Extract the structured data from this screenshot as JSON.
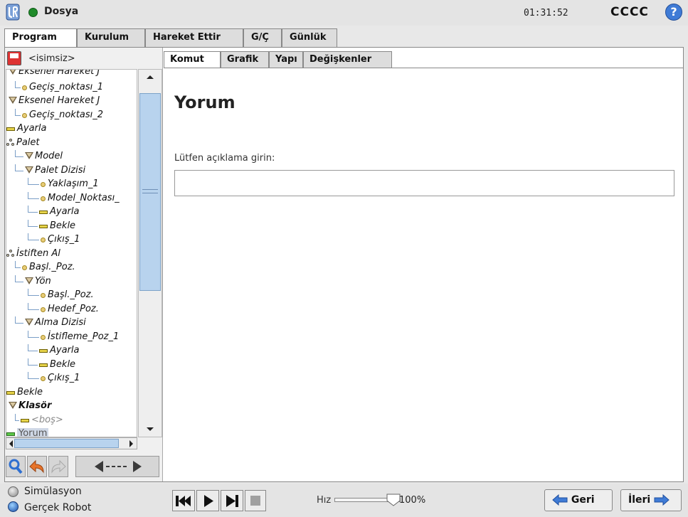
{
  "header": {
    "file_menu": "Dosya",
    "clock": "01:31:52",
    "robot_name": "CCCC",
    "help": "?"
  },
  "main_tabs": [
    {
      "label": "Program",
      "active": true
    },
    {
      "label": "Kurulum",
      "active": false
    },
    {
      "label": "Hareket Ettir",
      "active": false
    },
    {
      "label": "G/Ç",
      "active": false
    },
    {
      "label": "Günlük",
      "active": false
    }
  ],
  "program": {
    "name": "<isimsiz>"
  },
  "tree": [
    {
      "label": "Eksenel Hareket J",
      "icon": "move-icon"
    },
    {
      "label": "Geçiş_noktası_1",
      "icon": "waypoint-icon"
    },
    {
      "label": "Eksenel Hareket J",
      "icon": "move-icon"
    },
    {
      "label": "Geçiş_noktası_2",
      "icon": "waypoint-icon"
    },
    {
      "label": "Ayarla",
      "icon": "set-icon"
    },
    {
      "label": "Palet",
      "icon": "pallet-icon"
    },
    {
      "label": "Model",
      "icon": "move-icon"
    },
    {
      "label": "Palet Dizisi",
      "icon": "move-icon"
    },
    {
      "label": "Yaklaşım_1",
      "icon": "waypoint-icon"
    },
    {
      "label": "Model_Noktası_",
      "icon": "waypoint-icon"
    },
    {
      "label": "Ayarla",
      "icon": "set-icon"
    },
    {
      "label": "Bekle",
      "icon": "wait-icon"
    },
    {
      "label": "Çıkış_1",
      "icon": "waypoint-icon"
    },
    {
      "label": "İstiften Al",
      "icon": "pallet-icon"
    },
    {
      "label": "Başl._Poz.",
      "icon": "waypoint-icon"
    },
    {
      "label": "Yön",
      "icon": "move-icon"
    },
    {
      "label": "Başl._Poz.",
      "icon": "waypoint-icon"
    },
    {
      "label": "Hedef_Poz.",
      "icon": "waypoint-icon"
    },
    {
      "label": "Alma Dizisi",
      "icon": "move-icon"
    },
    {
      "label": "İstifleme_Poz_1",
      "icon": "waypoint-icon"
    },
    {
      "label": "Ayarla",
      "icon": "set-icon"
    },
    {
      "label": "Bekle",
      "icon": "wait-icon"
    },
    {
      "label": "Çıkış_1",
      "icon": "waypoint-icon"
    },
    {
      "label": "Bekle",
      "icon": "wait-icon"
    },
    {
      "label": "Klasör",
      "icon": "folder-icon"
    },
    {
      "label": "<boş>",
      "icon": "empty-icon"
    },
    {
      "label": "Yorum",
      "icon": "comment-icon",
      "selected": true
    }
  ],
  "sub_tabs": [
    {
      "label": "Komut",
      "active": true
    },
    {
      "label": "Grafik",
      "active": false
    },
    {
      "label": "Yapı",
      "active": false
    },
    {
      "label": "Değişkenler",
      "active": false
    }
  ],
  "command": {
    "title": "Yorum",
    "prompt": "Lütfen açıklama girin:",
    "value": ""
  },
  "mode": {
    "simulation": "Simülasyon",
    "real_robot": "Gerçek Robot",
    "selected": "Gerçek Robot"
  },
  "speed": {
    "label": "Hız",
    "value_text": "100%",
    "fraction": 1.0
  },
  "navigation": {
    "back": "Geri",
    "next": "İleri"
  },
  "colors": {
    "accent_blue": "#3f7bd6",
    "selection": "#b8d3ee",
    "wait_yellow": "#e6d34a",
    "comment_green": "#5cc94a"
  }
}
